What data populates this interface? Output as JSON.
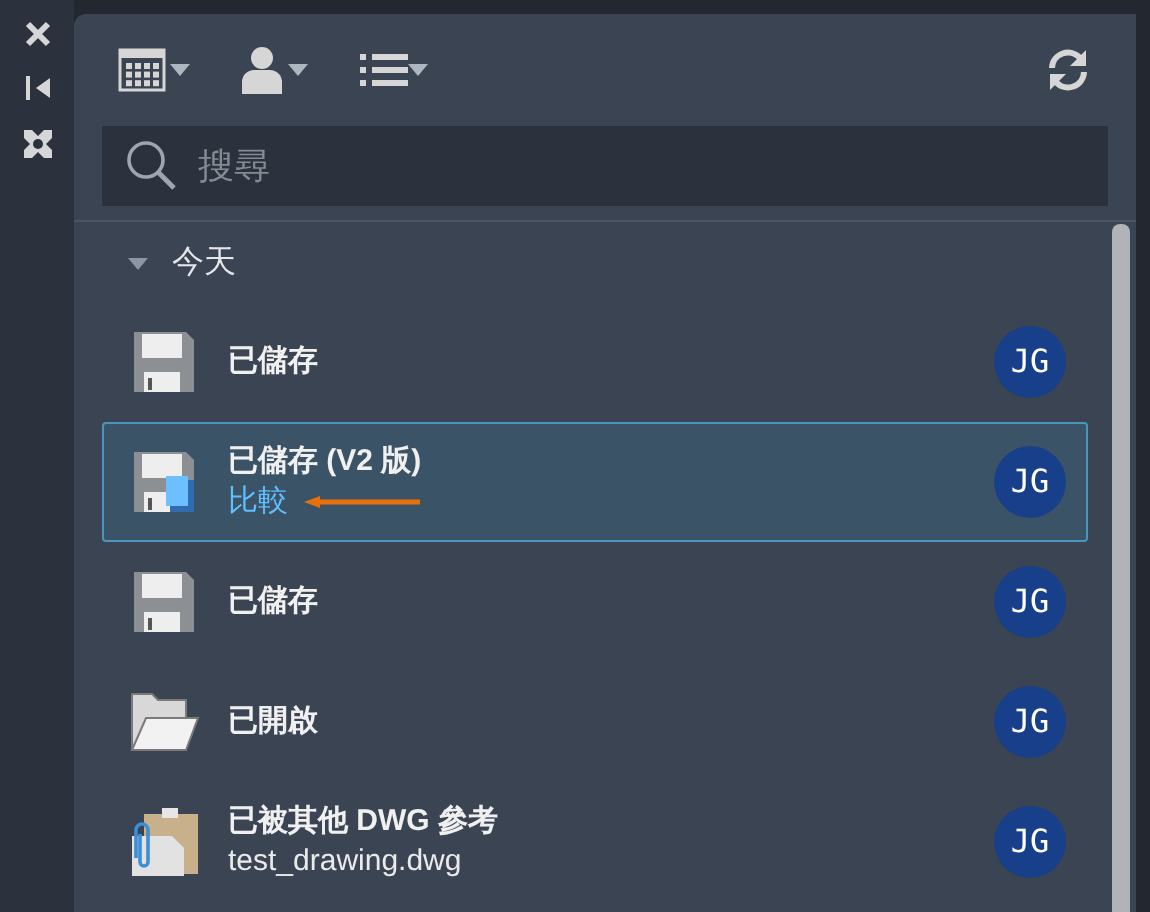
{
  "search": {
    "placeholder": "搜尋"
  },
  "group": {
    "label": "今天",
    "expanded": true
  },
  "items": [
    {
      "kind": "save",
      "title": "已儲存",
      "initials": "JG",
      "selected": false
    },
    {
      "kind": "save-compare",
      "title": "已儲存 (V2 版)",
      "link": "比較",
      "initials": "JG",
      "selected": true
    },
    {
      "kind": "save",
      "title": "已儲存",
      "initials": "JG",
      "selected": false
    },
    {
      "kind": "open",
      "title": "已開啟",
      "initials": "JG",
      "selected": false
    },
    {
      "kind": "xref",
      "title": "已被其他 DWG 參考",
      "subtitle": "test_drawing.dwg",
      "initials": "JG",
      "selected": false
    }
  ]
}
